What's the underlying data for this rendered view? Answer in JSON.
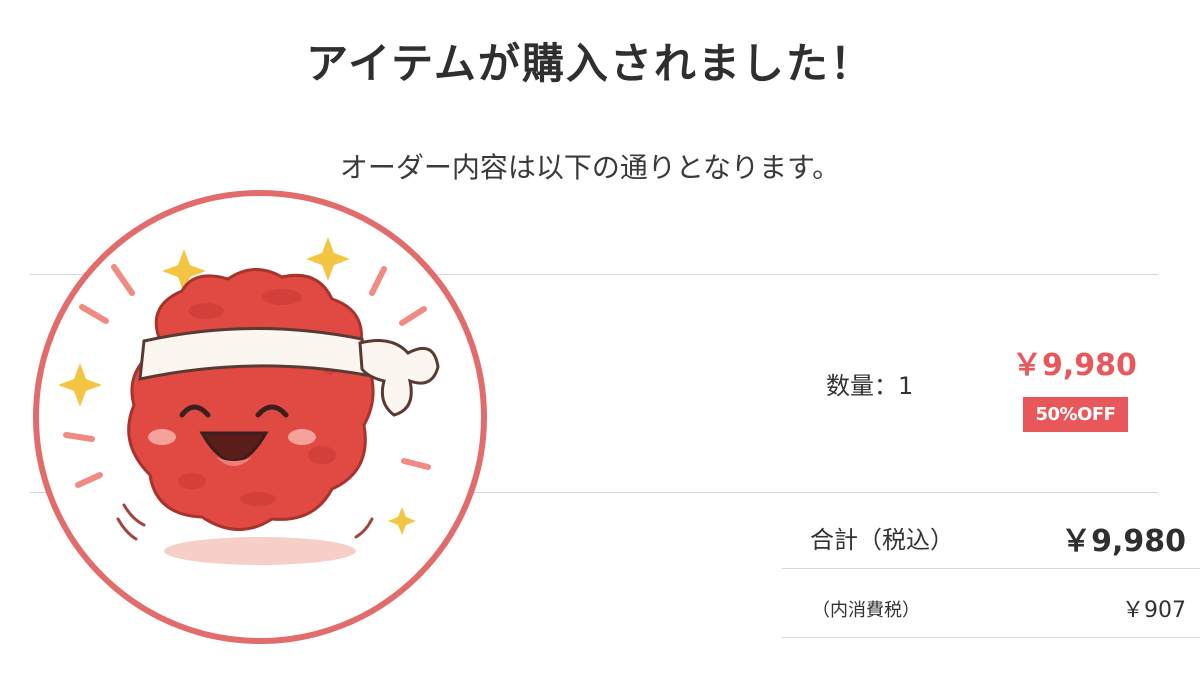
{
  "header": {
    "title": "アイテムが購入されました！",
    "subtitle": "オーダー内容は以下の通りとなります。"
  },
  "order_item": {
    "image_icon": "meatball-character-icon",
    "quantity_text": "数量：1",
    "price": "￥9,980",
    "discount_badge": "50%OFF"
  },
  "summary": {
    "total_label": "合計（税込）",
    "total_value": "￥9,980",
    "tax_label": "（内消費税）",
    "tax_value": "￥907"
  },
  "colors": {
    "accent": "#e8585a",
    "text": "#333333",
    "divider": "#d6d6d6"
  }
}
